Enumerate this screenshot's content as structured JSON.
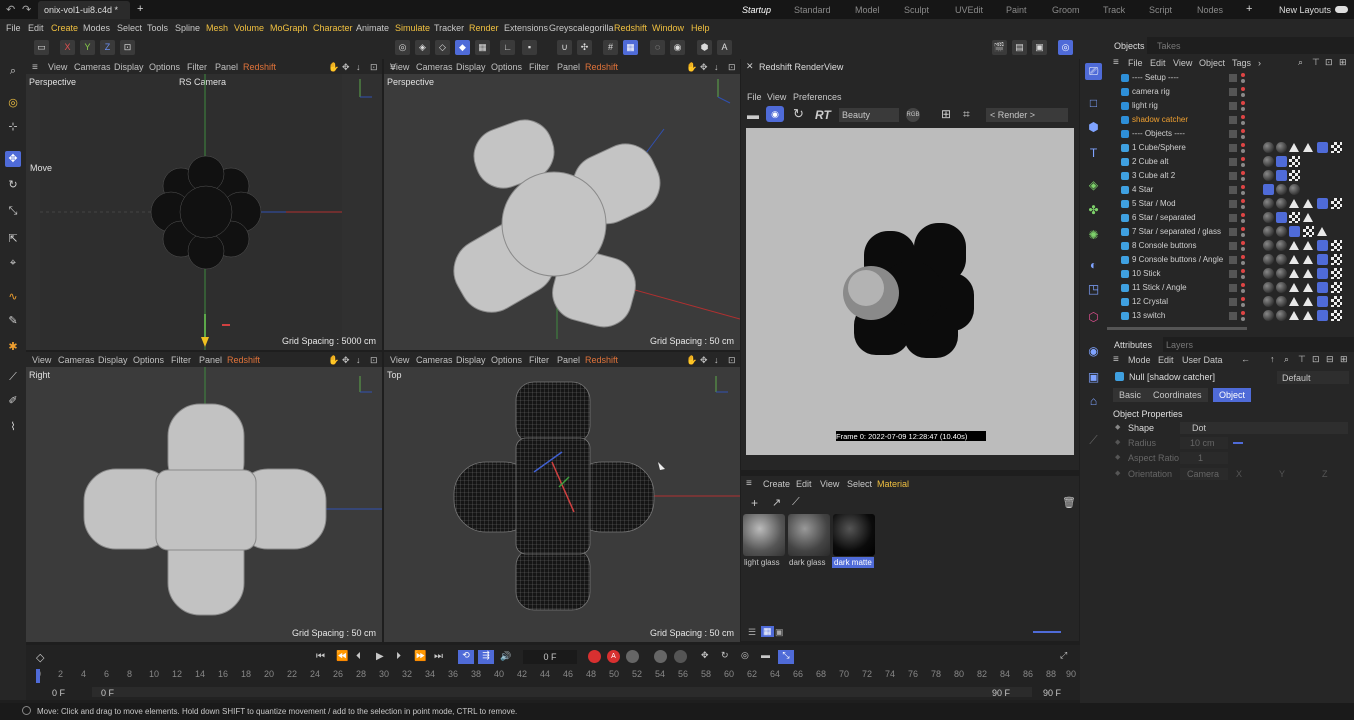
{
  "titlebar": {
    "tab": "onix-vol1-ui8.c4d *",
    "plus": "+",
    "layouts": [
      "Startup",
      "Standard",
      "Model",
      "Sculpt",
      "UVEdit",
      "Paint",
      "Groom",
      "Track",
      "Script",
      "Nodes"
    ],
    "new_layouts": "New Layouts"
  },
  "menu": [
    "File",
    "Edit",
    "Create",
    "Modes",
    "Select",
    "Tools",
    "Spline",
    "Mesh",
    "Volume",
    "MoGraph",
    "Character",
    "Animate",
    "Simulate",
    "Tracker",
    "Render",
    "Extensions",
    "Greyscalegorilla",
    "Redshift",
    "Window",
    "Help"
  ],
  "toolbar": {
    "x": "X",
    "y": "Y",
    "z": "Z"
  },
  "vp_menu": [
    "View",
    "Cameras",
    "Display",
    "Options",
    "Filter",
    "Panel",
    "Redshift"
  ],
  "viewports": [
    {
      "label": "Perspective",
      "camera": "RS Camera",
      "mode": "Move",
      "grid": "Grid Spacing : 5000 cm"
    },
    {
      "label": "Perspective",
      "grid": "Grid Spacing : 50 cm"
    },
    {
      "label": "Right",
      "grid": "Grid Spacing : 50 cm"
    },
    {
      "label": "Top",
      "grid": "Grid Spacing : 50 cm"
    }
  ],
  "renderview": {
    "title": "Redshift RenderView",
    "menu": [
      "File",
      "View",
      "Preferences"
    ],
    "rt": "RT",
    "aov": "Beauty",
    "rgb": "RGB",
    "render_select": "< Render >",
    "frame_info": "Frame  0:  2022-07-09  12:28:47  (10.40s)"
  },
  "material": {
    "menu": [
      "Create",
      "Edit",
      "View",
      "Select",
      "Material"
    ],
    "items": [
      "light glass",
      "dark glass",
      "dark matte"
    ]
  },
  "timeline": {
    "frame_field": "0 F",
    "ticks": [
      "0",
      "2",
      "4",
      "6",
      "8",
      "10",
      "12",
      "14",
      "16",
      "18",
      "20",
      "22",
      "24",
      "26",
      "28",
      "30",
      "32",
      "34",
      "36",
      "38",
      "40",
      "42",
      "44",
      "46",
      "48",
      "50",
      "52",
      "54",
      "56",
      "58",
      "60",
      "62",
      "64",
      "66",
      "68",
      "70",
      "72",
      "74",
      "76",
      "78",
      "80",
      "82",
      "84",
      "86",
      "88",
      "90"
    ],
    "start": "0 F",
    "start2": "0 F",
    "end": "90 F",
    "end2": "90 F"
  },
  "status": "Move: Click and drag to move elements. Hold down SHIFT to quantize movement / add to the selection in point mode, CTRL to remove.",
  "objects": {
    "tabs": [
      "Objects",
      "Takes"
    ],
    "menu": [
      "File",
      "Edit",
      "View",
      "Object",
      "Tags"
    ],
    "rows": [
      "---- Setup ----",
      "camera rig",
      "light rig",
      "shadow catcher",
      "---- Objects ----",
      "1 Cube/Sphere",
      "2 Cube alt",
      "3 Cube alt 2",
      "4 Star",
      "5 Star / Mod",
      "6 Star / separated",
      "7 Star / separated / glass",
      "8 Console buttons",
      "9 Console buttons / Angle",
      "10 Stick",
      "11 Stick / Angle",
      "12 Crystal",
      "13  switch"
    ]
  },
  "attributes": {
    "tabs": [
      "Attributes",
      "Layers"
    ],
    "menu": [
      "Mode",
      "Edit",
      "User Data"
    ],
    "object": "Null [shadow catcher]",
    "preset": "Default",
    "subtabs": [
      "Basic",
      "Coordinates",
      "Object"
    ],
    "section": "Object Properties",
    "props": [
      {
        "label": "Shape",
        "value": "Dot"
      },
      {
        "label": "Radius",
        "value": "10 cm"
      },
      {
        "label": "Aspect Ratio",
        "value": "1"
      },
      {
        "label": "Orientation",
        "value": "Camera"
      }
    ],
    "axes": [
      "X",
      "Y",
      "Z"
    ]
  },
  "colors": {
    "accent": "#4f6bd8",
    "redshift": "#e0733a",
    "selected": "#f0a030"
  }
}
